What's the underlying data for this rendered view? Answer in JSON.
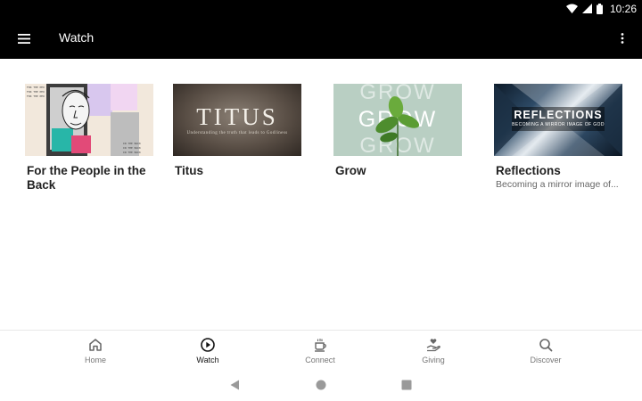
{
  "status_bar": {
    "time": "10:26",
    "icons": [
      "wifi-icon",
      "signal-icon",
      "battery-icon"
    ]
  },
  "app_bar": {
    "title": "Watch",
    "menu_icon": "hamburger-menu-icon",
    "more_icon": "more-vert-icon"
  },
  "cards": [
    {
      "title": "For the People in the Back",
      "subtitle": ""
    },
    {
      "title": "Titus",
      "subtitle": "",
      "thumb_text": "TITUS",
      "thumb_subtext": "Understanding the truth that leads to Godliness"
    },
    {
      "title": "Grow",
      "subtitle": "",
      "thumb_text": "GROW"
    },
    {
      "title": "Reflections",
      "subtitle": "Becoming a mirror image of...",
      "thumb_text": "REFLECTIONS",
      "thumb_subtext": "BECOMING A MIRROR IMAGE OF GOD"
    }
  ],
  "bottom_nav": [
    {
      "label": "Home",
      "icon": "home-icon",
      "active": false
    },
    {
      "label": "Watch",
      "icon": "play-circle-icon",
      "active": true
    },
    {
      "label": "Connect",
      "icon": "coffee-cup-icon",
      "active": false
    },
    {
      "label": "Giving",
      "icon": "hand-heart-icon",
      "active": false
    },
    {
      "label": "Discover",
      "icon": "search-icon",
      "active": false
    }
  ],
  "system_nav": [
    "back-icon",
    "home-circle-icon",
    "recents-square-icon"
  ],
  "colors": {
    "app_bar_bg": "#000000",
    "active_nav": "#111111",
    "inactive_nav": "#777777"
  }
}
